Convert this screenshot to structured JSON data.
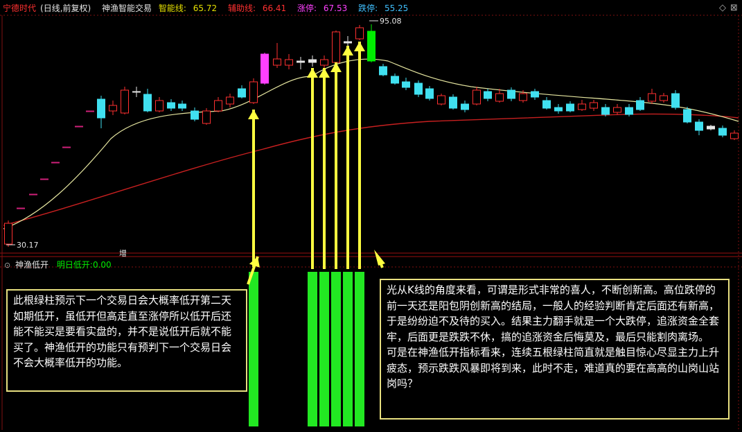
{
  "header": {
    "stock_name": "宁德时代",
    "period": "(日线,前复权)",
    "indicator_name": "神渔智能交易",
    "line1_label": "智能线:",
    "line1_value": "65.72",
    "line2_label": "辅助线:",
    "line2_value": "66.41",
    "limit_up_label": "涨停:",
    "limit_up_value": "67.53",
    "limit_down_label": "跌停:",
    "limit_down_value": "55.25",
    "colors": {
      "stock": "#ff3030",
      "white": "#e6e6e6",
      "yellow": "#e6e000",
      "red": "#ff3030",
      "magenta": "#ff40ff",
      "cyan": "#40c0ff"
    }
  },
  "controls": {
    "diamond_icon": "diamond-icon",
    "close_icon": "close-icon"
  },
  "price_labels": {
    "high": "95.08",
    "low": "30.17"
  },
  "marker": "增",
  "lower_panel": {
    "name": "神渔低开",
    "value_label": "明日低开:",
    "value": "0.00",
    "name_color": "#e6e6e6",
    "value_color": "#00ee00"
  },
  "annotations": {
    "left_text": "此根绿柱预示下一个交易日会大概率低开第二天如期低开，虽低开但高走直至涨停所以低开后还能不能买是要看实盘的，并不是说低开后就不能买了。神渔低开的功能只有预判下一个交易日会不会大概率低开的功能。",
    "right_text_1": "光从K线的角度来看，可谓是形式非常的喜人，不断创新高。高位跌停的前一天还是阳包阴创新高的结局，一般人的经验判断肯定后面还有新高，于是纷纷迫不及待的买入。结果主力翻手就是一个大跌停，追涨资金全套牢，后面更是跌跌不休，搞的追涨资金后悔莫及，最后只能割肉离场。",
    "right_text_2": "可是在神渔低开指标看来，连续五根绿柱简直就是触目惊心尽显主力上升疲态，预示跌跌风暴即将到来，此时不走，难道真的要在高高的山岗山站岗吗？"
  }
}
